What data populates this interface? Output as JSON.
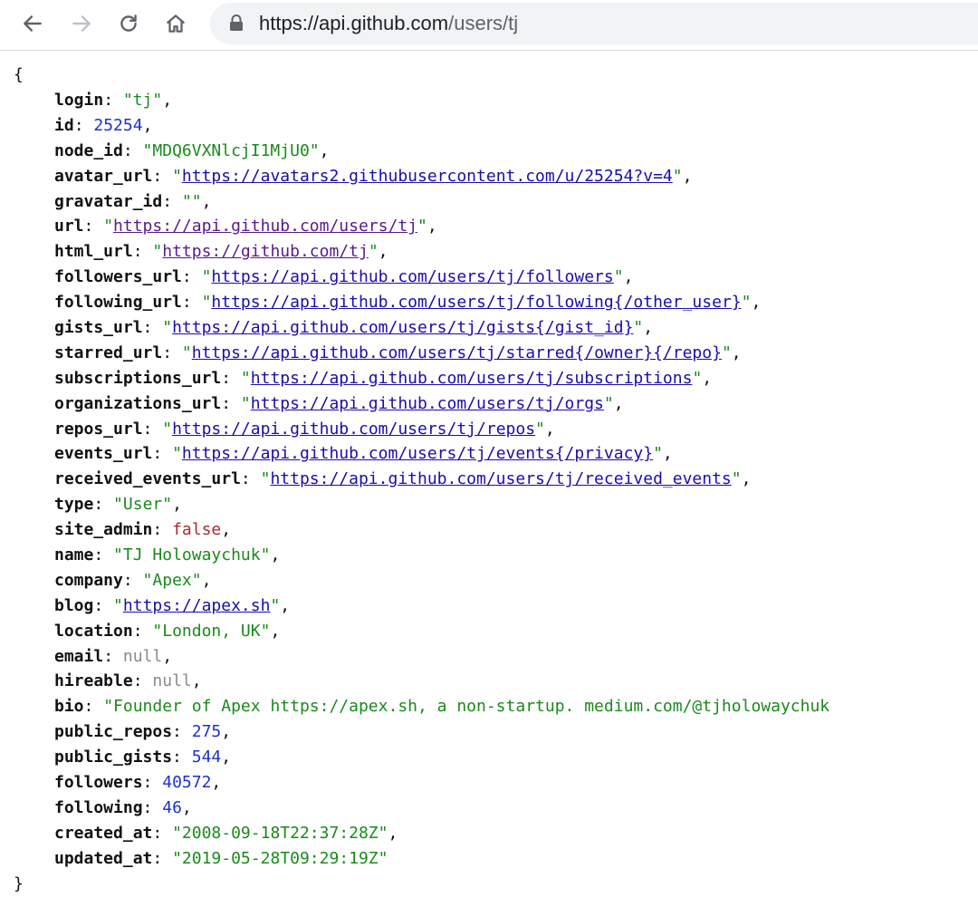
{
  "browser": {
    "url_host": "https://api.github.com",
    "url_path": "/users/tj",
    "back_icon": "arrow-left-icon",
    "forward_icon": "arrow-right-icon",
    "reload_icon": "reload-icon",
    "home_icon": "home-icon",
    "lock_icon": "lock-icon"
  },
  "json": {
    "open_brace": "{",
    "close_brace": "}",
    "fields": [
      {
        "key": "login",
        "value": "tj",
        "type": "string"
      },
      {
        "key": "id",
        "value": "25254",
        "type": "number"
      },
      {
        "key": "node_id",
        "value": "MDQ6VXNlcjI1MjU0",
        "type": "string"
      },
      {
        "key": "avatar_url",
        "value": "https://avatars2.githubusercontent.com/u/25254?v=4",
        "type": "link"
      },
      {
        "key": "gravatar_id",
        "value": "",
        "type": "string"
      },
      {
        "key": "url",
        "value": "https://api.github.com/users/tj",
        "type": "link-visited"
      },
      {
        "key": "html_url",
        "value": "https://github.com/tj",
        "type": "link-visited"
      },
      {
        "key": "followers_url",
        "value": "https://api.github.com/users/tj/followers",
        "type": "link"
      },
      {
        "key": "following_url",
        "value": "https://api.github.com/users/tj/following{/other_user}",
        "type": "link"
      },
      {
        "key": "gists_url",
        "value": "https://api.github.com/users/tj/gists{/gist_id}",
        "type": "link"
      },
      {
        "key": "starred_url",
        "value": "https://api.github.com/users/tj/starred{/owner}{/repo}",
        "type": "link"
      },
      {
        "key": "subscriptions_url",
        "value": "https://api.github.com/users/tj/subscriptions",
        "type": "link"
      },
      {
        "key": "organizations_url",
        "value": "https://api.github.com/users/tj/orgs",
        "type": "link"
      },
      {
        "key": "repos_url",
        "value": "https://api.github.com/users/tj/repos",
        "type": "link"
      },
      {
        "key": "events_url",
        "value": "https://api.github.com/users/tj/events{/privacy}",
        "type": "link"
      },
      {
        "key": "received_events_url",
        "value": "https://api.github.com/users/tj/received_events",
        "type": "link"
      },
      {
        "key": "type",
        "value": "User",
        "type": "string"
      },
      {
        "key": "site_admin",
        "value": "false",
        "type": "bool"
      },
      {
        "key": "name",
        "value": "TJ Holowaychuk",
        "type": "string"
      },
      {
        "key": "company",
        "value": "Apex",
        "type": "string"
      },
      {
        "key": "blog",
        "value": "https://apex.sh",
        "type": "link"
      },
      {
        "key": "location",
        "value": "London, UK",
        "type": "string"
      },
      {
        "key": "email",
        "value": "null",
        "type": "null"
      },
      {
        "key": "hireable",
        "value": "null",
        "type": "null"
      },
      {
        "key": "bio",
        "value": "Founder of Apex https://apex.sh, a non-startup. medium.com/@tjholowaychuk",
        "type": "string-cut"
      },
      {
        "key": "public_repos",
        "value": "275",
        "type": "number"
      },
      {
        "key": "public_gists",
        "value": "544",
        "type": "number"
      },
      {
        "key": "followers",
        "value": "40572",
        "type": "number"
      },
      {
        "key": "following",
        "value": "46",
        "type": "number"
      },
      {
        "key": "created_at",
        "value": "2008-09-18T22:37:28Z",
        "type": "string"
      },
      {
        "key": "updated_at",
        "value": "2019-05-28T09:29:19Z",
        "type": "string-last"
      }
    ]
  },
  "colors": {
    "string": "#1a8a1a",
    "number": "#1c31d1",
    "bool": "#b3262c",
    "null": "#8a8a8a",
    "link": "#1a0dab",
    "link_visited": "#5a1a8a"
  }
}
